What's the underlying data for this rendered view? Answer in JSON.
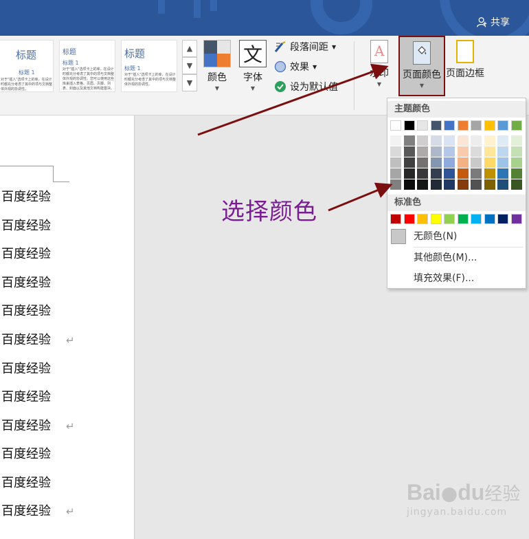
{
  "titlebar": {
    "share_label": "共享"
  },
  "styles": [
    {
      "heading": "标题",
      "sub": "标题 1",
      "body": "对于\"插入\"选项卡上的库，在设计时都充分考虑了其中的项与文档整体外观的协调性。"
    },
    {
      "heading": "标题",
      "sub": "标题 1",
      "body": "对于\"插入\"选项卡上的库，在设计时都充分考虑了其中的项与文档整体外观的协调性。您可以使用这些库来插入表格、页眉、页脚、列表、封面以及其他文档构建基块。"
    },
    {
      "heading": "标题",
      "sub": "标题 1",
      "body": "对于\"插入\"选项卡上的库，在设计时都充分考虑了其中的项与文档整体外观的协调性。"
    }
  ],
  "ribbon": {
    "colors_label": "颜色",
    "fonts_label": "字体",
    "fonts_glyph": "文",
    "paragraph_spacing": "段落间距",
    "effects": "效果",
    "set_default": "设为默认值",
    "watermark": "水印",
    "page_color": "页面颜色",
    "page_border": "页面边框"
  },
  "document": {
    "lines": [
      "百度经验",
      "百度经验",
      "百度经验",
      "百度经验",
      "百度经验",
      "百度经验",
      "百度经验",
      "百度经验",
      "百度经验",
      "百度经验",
      "百度经验",
      "百度经验"
    ],
    "paragraph_mark": "↵",
    "lines_with_mark": [
      5,
      8,
      11
    ]
  },
  "dropdown": {
    "theme_header": "主题颜色",
    "standard_header": "标准色",
    "no_color": "无颜色(N)",
    "more_colors": "其他颜色(M)...",
    "fill_effects": "填充效果(F)...",
    "theme_top": [
      "#ffffff",
      "#000000",
      "#e7e6e6",
      "#44546a",
      "#4472c4",
      "#ed7d31",
      "#a5a5a5",
      "#ffc000",
      "#5b9bd5",
      "#70ad47"
    ],
    "theme_shades": [
      [
        "#f2f2f2",
        "#d9d9d9",
        "#bfbfbf",
        "#a6a6a6",
        "#808080"
      ],
      [
        "#808080",
        "#595959",
        "#404040",
        "#262626",
        "#0d0d0d"
      ],
      [
        "#d0cece",
        "#aeaaaa",
        "#757171",
        "#3a3838",
        "#171616"
      ],
      [
        "#d6dce5",
        "#adb9ca",
        "#8497b0",
        "#333f50",
        "#222a35"
      ],
      [
        "#dae3f3",
        "#b4c7e7",
        "#8faadc",
        "#2f5597",
        "#203864"
      ],
      [
        "#fbe5d6",
        "#f8cbad",
        "#f4b183",
        "#c55a11",
        "#843c0c"
      ],
      [
        "#ededed",
        "#dbdbdb",
        "#c9c9c9",
        "#7b7b7b",
        "#525252"
      ],
      [
        "#fff2cc",
        "#ffe699",
        "#ffd966",
        "#bf9000",
        "#7f6000"
      ],
      [
        "#deebf7",
        "#bdd7ee",
        "#9dc3e6",
        "#2e75b6",
        "#1f4e79"
      ],
      [
        "#e2f0d9",
        "#c5e0b4",
        "#a9d18e",
        "#548235",
        "#385723"
      ]
    ],
    "standard": [
      "#c00000",
      "#ff0000",
      "#ffc000",
      "#ffff00",
      "#92d050",
      "#00b050",
      "#00b0f0",
      "#0070c0",
      "#002060",
      "#7030a0"
    ]
  },
  "annotation": {
    "text": "选择颜色",
    "color": "#7a1d94",
    "arrow_color": "#7b0f0f"
  },
  "watermark": {
    "brand": "Bai",
    "brand_mid": "du",
    "brand_cn": "经验",
    "url": "jingyan.baidu.com"
  }
}
